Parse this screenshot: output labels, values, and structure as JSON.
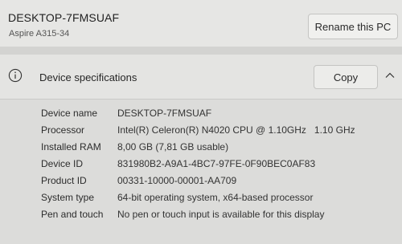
{
  "device": {
    "name": "DESKTOP-7FMSUAF",
    "model": "Aspire A315-34",
    "rename_label": "Rename this PC"
  },
  "specifications": {
    "title": "Device specifications",
    "copy_label": "Copy",
    "icons": {
      "info": "info-circle-icon",
      "collapse": "chevron-up-icon"
    },
    "rows": [
      {
        "label": "Device name",
        "value": "DESKTOP-7FMSUAF"
      },
      {
        "label": "Processor",
        "value": "Intel(R) Celeron(R) N4020 CPU @ 1.10GHz   1.10 GHz"
      },
      {
        "label": "Installed RAM",
        "value": "8,00 GB (7,81 GB usable)"
      },
      {
        "label": "Device ID",
        "value": "831980B2-A9A1-4BC7-97FE-0F90BEC0AF83"
      },
      {
        "label": "Product ID",
        "value": "00331-10000-00001-AA709"
      },
      {
        "label": "System type",
        "value": "64-bit operating system, x64-based processor"
      },
      {
        "label": "Pen and touch",
        "value": "No pen or touch input is available for this display"
      }
    ]
  }
}
